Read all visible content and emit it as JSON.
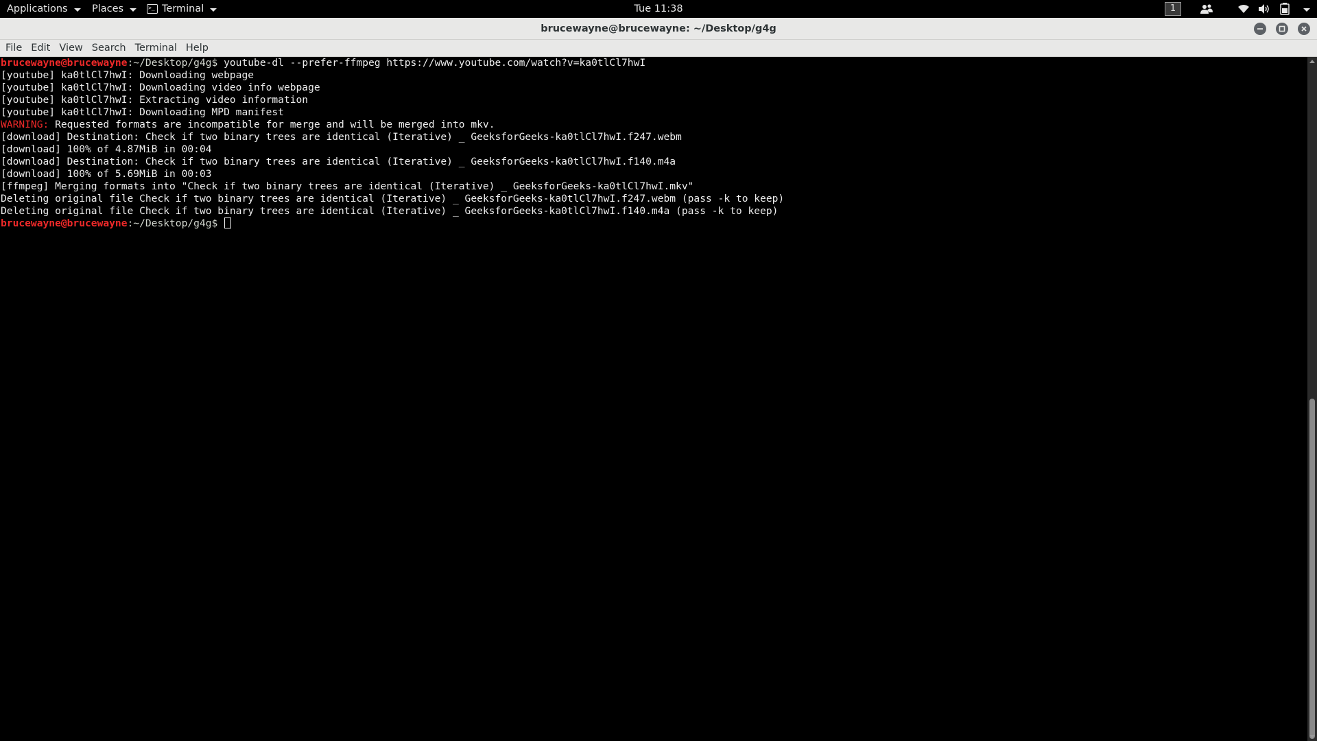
{
  "topbar": {
    "applications": "Applications",
    "places": "Places",
    "terminal": "Terminal",
    "clock": "Tue 11:38",
    "workspace": "1",
    "tray_icons": [
      "people-icon",
      "wifi-icon",
      "volume-icon",
      "battery-icon",
      "system-menu-icon"
    ]
  },
  "window": {
    "title": "brucewayne@brucewayne: ~/Desktop/g4g",
    "buttons": [
      "minimize",
      "maximize",
      "close"
    ]
  },
  "menubar": {
    "file": "File",
    "edit": "Edit",
    "view": "View",
    "search": "Search",
    "terminal": "Terminal",
    "help": "Help"
  },
  "terminal": {
    "prompt_user": "brucewayne@brucewayne",
    "prompt_path": ":~/Desktop/g4g$ ",
    "command": "youtube-dl --prefer-ffmpeg https://www.youtube.com/watch?v=ka0tlCl7hwI",
    "output": [
      "[youtube] ka0tlCl7hwI: Downloading webpage",
      "[youtube] ka0tlCl7hwI: Downloading video info webpage",
      "[youtube] ka0tlCl7hwI: Extracting video information",
      "[youtube] ka0tlCl7hwI: Downloading MPD manifest"
    ],
    "warning_label": "WARNING:",
    "warning_text": " Requested formats are incompatible for merge and will be merged into mkv.",
    "output2": [
      "[download] Destination: Check if two binary trees are identical (Iterative) _ GeeksforGeeks-ka0tlCl7hwI.f247.webm",
      "[download] 100% of 4.87MiB in 00:04",
      "[download] Destination: Check if two binary trees are identical (Iterative) _ GeeksforGeeks-ka0tlCl7hwI.f140.m4a",
      "[download] 100% of 5.69MiB in 00:03",
      "[ffmpeg] Merging formats into \"Check if two binary trees are identical (Iterative) _ GeeksforGeeks-ka0tlCl7hwI.mkv\"",
      "Deleting original file Check if two binary trees are identical (Iterative) _ GeeksforGeeks-ka0tlCl7hwI.f247.webm (pass -k to keep)",
      "Deleting original file Check if two binary trees are identical (Iterative) _ GeeksforGeeks-ka0tlCl7hwI.f140.m4a (pass -k to keep)"
    ],
    "final_prompt_user": "brucewayne@brucewayne",
    "final_prompt_path": ":~/Desktop/g4g$ "
  },
  "colors": {
    "background": "#000000",
    "text": "#ececec",
    "prompt": "#ef2929",
    "warning": "#ef2929",
    "chrome": "#e8e8e7"
  }
}
